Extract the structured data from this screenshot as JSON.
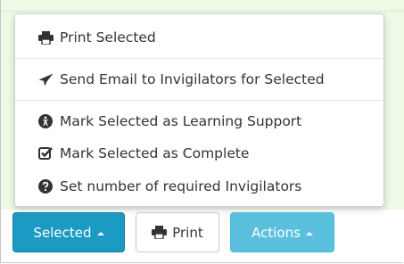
{
  "menu": {
    "items": [
      {
        "label": "Print Selected",
        "icon": "print-icon"
      },
      {
        "label": "Send Email to Invigilators for Selected",
        "icon": "send-icon"
      },
      {
        "label": "Mark Selected as Learning Support",
        "icon": "accessibility-icon"
      },
      {
        "label": "Mark Selected as Complete",
        "icon": "check-square-icon"
      },
      {
        "label": "Set number of required Invigilators",
        "icon": "question-circle-icon"
      }
    ]
  },
  "toolbar": {
    "selected_label": "Selected",
    "print_label": "Print",
    "actions_label": "Actions"
  },
  "colors": {
    "primary": "#1b9bc4",
    "info": "#5bc0de",
    "row_background": "#ecfae6"
  }
}
